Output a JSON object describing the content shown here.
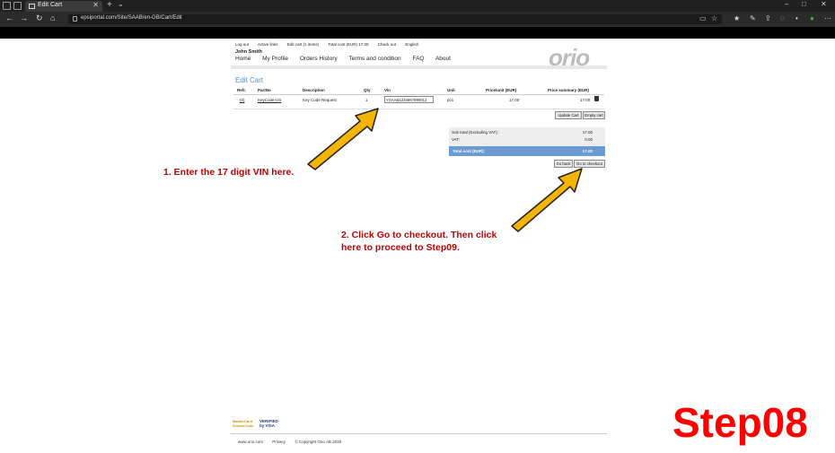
{
  "browser": {
    "tab_title": "Edit Cart",
    "url": "epsiportal.com/Site/SAAB/en-GB/Cart/Edit"
  },
  "portal": {
    "top_links": [
      "Log out",
      "Active links",
      "Edit cart (1 items)",
      "Total cost (EUR) 17.00",
      "Check out",
      "English"
    ],
    "user_name": "John Smith",
    "nav": [
      "Home",
      "My Profile",
      "Orders History",
      "Terms and condition",
      "FAQ",
      "About"
    ],
    "logo_text": "orio",
    "section_title": "Edit Cart",
    "table": {
      "headers": [
        "Refr.",
        "PartNo",
        "Description",
        "Qty",
        "Vin",
        "Unit",
        "Price/unit (EUR)",
        "Price summary (EUR)"
      ],
      "row": {
        "ref": "(0)",
        "partno": "KeyCode-US",
        "description": "Key Code Request",
        "qty": "1",
        "vin": "YSAAB1234567890012",
        "unit": "pcs",
        "price_unit": "17.00",
        "price_summary": "17.00"
      }
    },
    "buttons": {
      "update_cart": "Update Cart",
      "empty_cart": "Empty cart",
      "go_back": "Go back",
      "go_to_checkout": "Go to checkout"
    },
    "summary": {
      "subtotal_label": "Sub total (Excluding VAT) :",
      "subtotal_value": "17.00",
      "vat_label": "VAT:",
      "vat_value": "0.00",
      "total_label": "Total cost (EUR):",
      "total_value": "17.00"
    },
    "payment": {
      "mastercard": "MasterCard SecureCode",
      "visa": "VERIFIED by VISA"
    },
    "footer": [
      "www.orio.com",
      "Privacy",
      "© Copyright Orio AB 2019"
    ]
  },
  "instructions": {
    "step1": "1. Enter the 17 digit VIN here.",
    "step2_line1": "2. Click Go to checkout. Then click",
    "step2_line2": "here to proceed to Step09."
  },
  "step_label": "Step08",
  "colors": {
    "instruction_red": "#c00000",
    "step_red": "#ff0000",
    "arrow_fill": "#f5b400",
    "total_bar": "#6b9bd2",
    "title_blue": "#5a8ec4"
  }
}
